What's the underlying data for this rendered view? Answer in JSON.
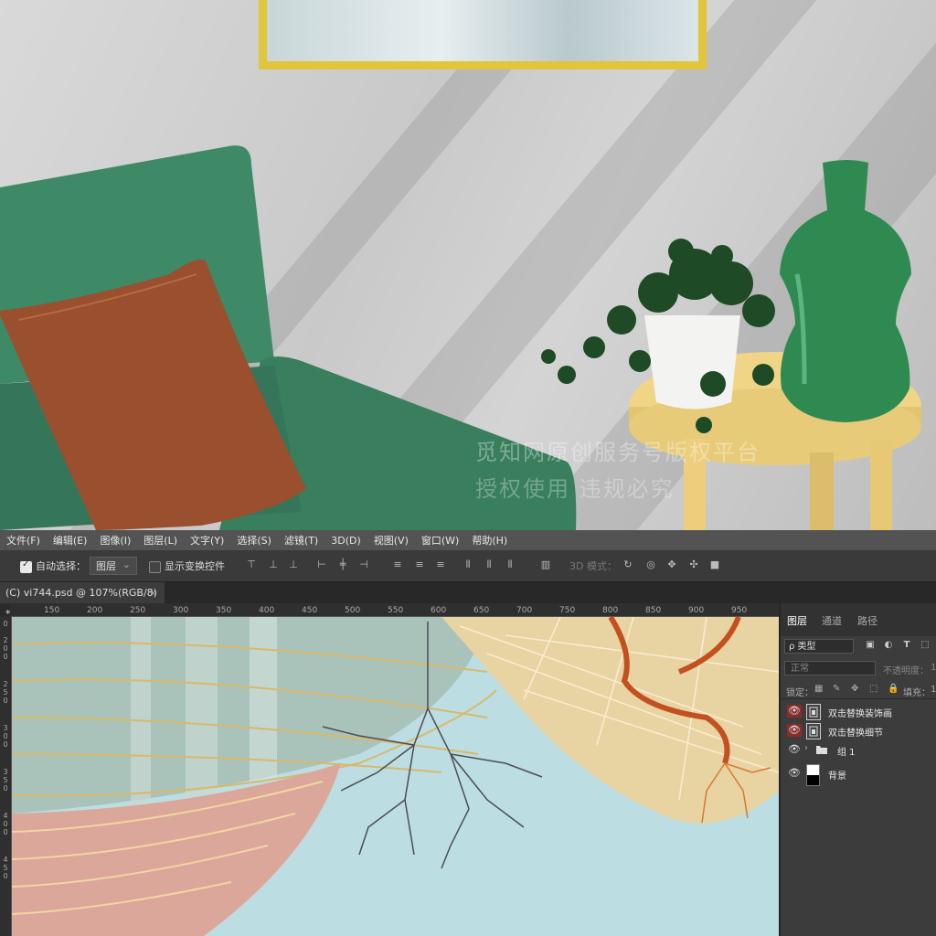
{
  "menu": [
    "文件(F)",
    "编辑(E)",
    "图像(I)",
    "图层(L)",
    "文字(Y)",
    "选择(S)",
    "滤镜(T)",
    "3D(D)",
    "视图(V)",
    "窗口(W)",
    "帮助(H)"
  ],
  "options": {
    "auto_select_label": "自动选择：",
    "auto_select_value": "图层",
    "show_transform_label": "显示变换控件",
    "mode_3d_label": "3D 模式："
  },
  "document": {
    "tab_title": "(C) vi744.psd @ 107%(RGB/8) *",
    "close": "×"
  },
  "ruler": {
    "h_ticks": [
      "150",
      "200",
      "250",
      "300",
      "350",
      "400",
      "450",
      "500",
      "550",
      "600",
      "650",
      "700",
      "750",
      "800",
      "850",
      "900",
      "950"
    ],
    "v_ticks": [
      "0",
      "2",
      "0",
      "0",
      "2",
      "5",
      "0",
      "3",
      "0",
      "0",
      "3",
      "5",
      "0",
      "4",
      "0",
      "0",
      "4",
      "5",
      "0"
    ]
  },
  "watermark": {
    "line1": "觅知网原创服务号版权平台",
    "line2": "授权使用 违规必究"
  },
  "panel": {
    "tabs": [
      "图层",
      "通道",
      "路径"
    ],
    "filter_label": "ρ 类型",
    "blend_mode": "正常",
    "opacity_label": "不透明度：",
    "opacity_value": "1",
    "lock_label": "锁定：",
    "fill_label": "填充：",
    "fill_value": "1",
    "layers": [
      {
        "name": "双击替换装饰画",
        "type": "smart"
      },
      {
        "name": "双击替换细节",
        "type": "smart"
      },
      {
        "name": "组 1",
        "type": "group"
      },
      {
        "name": "背景",
        "type": "background"
      }
    ]
  },
  "colors": {
    "menu_bg": "#535353",
    "panel_bg": "#3c3c3c",
    "eye_red": "#8b2b2b",
    "frame_gold": "#e1c53a",
    "sofa_green": "#3f8a66",
    "pillow_brown": "#9a4f2e",
    "table_yellow": "#f0d587",
    "vase_green": "#2f8a52"
  }
}
